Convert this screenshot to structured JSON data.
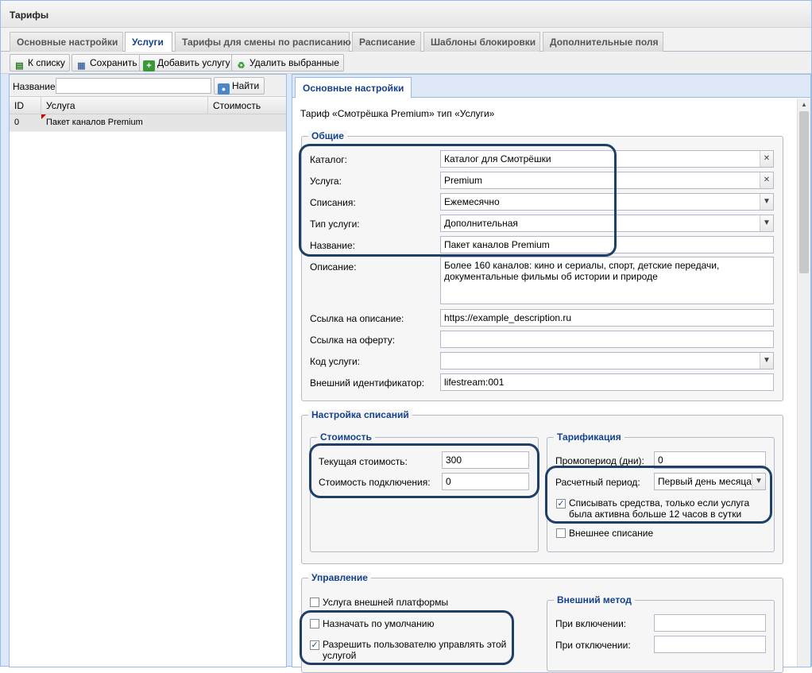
{
  "window": {
    "title": "Тарифы"
  },
  "main_tabs": [
    {
      "label": "Основные настройки"
    },
    {
      "label": "Услуги"
    },
    {
      "label": "Тарифы для смены по расписанию"
    },
    {
      "label": "Расписание"
    },
    {
      "label": "Шаблоны блокировки"
    },
    {
      "label": "Дополнительные поля"
    }
  ],
  "toolbar": {
    "to_list": "К списку",
    "save": "Сохранить",
    "add_service": "Добавить услугу",
    "delete_selected": "Удалить выбранные"
  },
  "search": {
    "label": "Название:",
    "value": "",
    "button": "Найти"
  },
  "grid": {
    "columns": [
      "ID",
      "Услуга",
      "Стоимость"
    ],
    "rows": [
      {
        "id": "0",
        "service": "Пакет каналов Premium",
        "cost": ""
      }
    ]
  },
  "detail_tab": "Основные настройки",
  "header_text": "Тариф «Смотрёшка Premium» тип «Услуги»",
  "general": {
    "legend": "Общие",
    "catalog_label": "Каталог:",
    "catalog_value": "Каталог для Смотрёшки",
    "service_label": "Услуга:",
    "service_value": "Premium",
    "charges_label": "Списания:",
    "charges_value": "Ежемесячно",
    "type_label": "Тип услуги:",
    "type_value": "Дополнительная",
    "name_label": "Название:",
    "name_value": "Пакет каналов Premium",
    "desc_label": "Описание:",
    "desc_value": "Более 160 каналов: кино и сериалы, спорт, детские передачи, документальные фильмы об истории и природе",
    "desc_link_label": "Ссылка на описание:",
    "desc_link_value": "https://example_description.ru",
    "offer_link_label": "Ссылка на оферту:",
    "offer_link_value": "",
    "code_label": "Код услуги:",
    "code_value": "",
    "ext_id_label": "Внешний идентификатор:",
    "ext_id_value": "lifestream:001"
  },
  "charges_setup": {
    "legend": "Настройка списаний",
    "cost": {
      "legend": "Стоимость",
      "current_label": "Текущая стоимость:",
      "current_value": "300",
      "connect_label": "Стоимость подключения:",
      "connect_value": "0"
    },
    "billing": {
      "legend": "Тарификация",
      "promo_label": "Промопериод (дни):",
      "promo_value": "0",
      "period_label": "Расчетный период:",
      "period_value": "Первый день месяца",
      "charge_active_label": "Списывать средства, только если услуга была активна больше 12 часов в сутки",
      "charge_active_checked": true,
      "external_charge_label": "Внешнее списание",
      "external_charge_checked": false
    }
  },
  "management": {
    "legend": "Управление",
    "ext_platform_label": "Услуга внешней платформы",
    "ext_platform_checked": false,
    "default_label": "Назначать по умолчанию",
    "default_checked": false,
    "allow_user_label": "Разрешить пользователю управлять этой услугой",
    "allow_user_checked": true,
    "ext_method": {
      "legend": "Внешний метод",
      "on_label": "При включении:",
      "on_value": "",
      "off_label": "При отключении:",
      "off_value": ""
    }
  },
  "icons": {
    "list": "list-icon",
    "save": "floppy-icon",
    "add": "plus-icon",
    "delete": "recycle-icon",
    "search": "magnifier-icon",
    "clear": "close-icon",
    "dropdown": "chevron-down-icon"
  },
  "colors": {
    "highlight": "#1e3f66",
    "accent": "#15428b"
  }
}
